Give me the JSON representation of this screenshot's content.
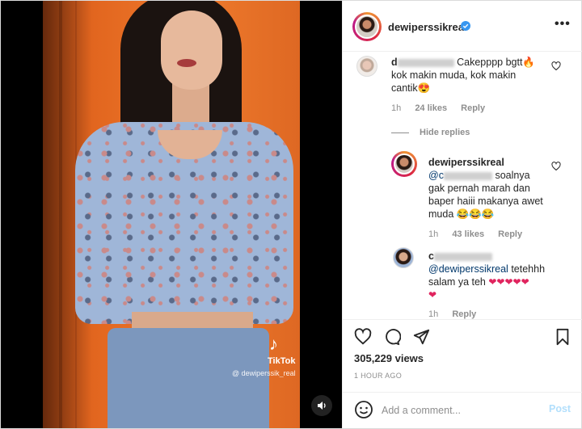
{
  "post": {
    "username": "dewiperssikreal",
    "verified": true,
    "more_icon": "more-horizontal-icon",
    "views": "305,229 views",
    "time_ago": "1 HOUR AGO"
  },
  "video": {
    "watermark_logo": "TikTok",
    "watermark_user": "@ dewiperssik_real",
    "sound_icon": "speaker-icon"
  },
  "comments": [
    {
      "username_prefix": "d",
      "text_line1": "Cakepppp bgtt🔥",
      "text_line2": "kok makin muda, kok makin",
      "text_line3": "cantik😍",
      "time": "1h",
      "likes": "24 likes",
      "reply_label": "Reply"
    }
  ],
  "hide_replies_label": "Hide replies",
  "replies": [
    {
      "username": "dewiperssikreal",
      "mention_prefix": "@c",
      "text_line1": "soalnya",
      "text_line2": "gak pernah marah dan",
      "text_line3": "baper haiii makanya awet",
      "text_line4": "muda 😂😂😂",
      "time": "1h",
      "likes": "43 likes",
      "reply_label": "Reply"
    },
    {
      "username_prefix": "c",
      "mention": "@dewiperssikreal",
      "text_line1": "tetehhh",
      "text_line2": "salam ya teh",
      "hearts_line2": "❤❤❤❤❤",
      "hearts_line3": "❤",
      "time": "1h",
      "reply_label": "Reply"
    }
  ],
  "add_comment": {
    "placeholder": "Add a comment...",
    "post_label": "Post"
  },
  "colors": {
    "verified": "#3897f0",
    "link": "#00376b",
    "muted": "#8e8e8e",
    "post_disabled": "#b2dffc"
  }
}
